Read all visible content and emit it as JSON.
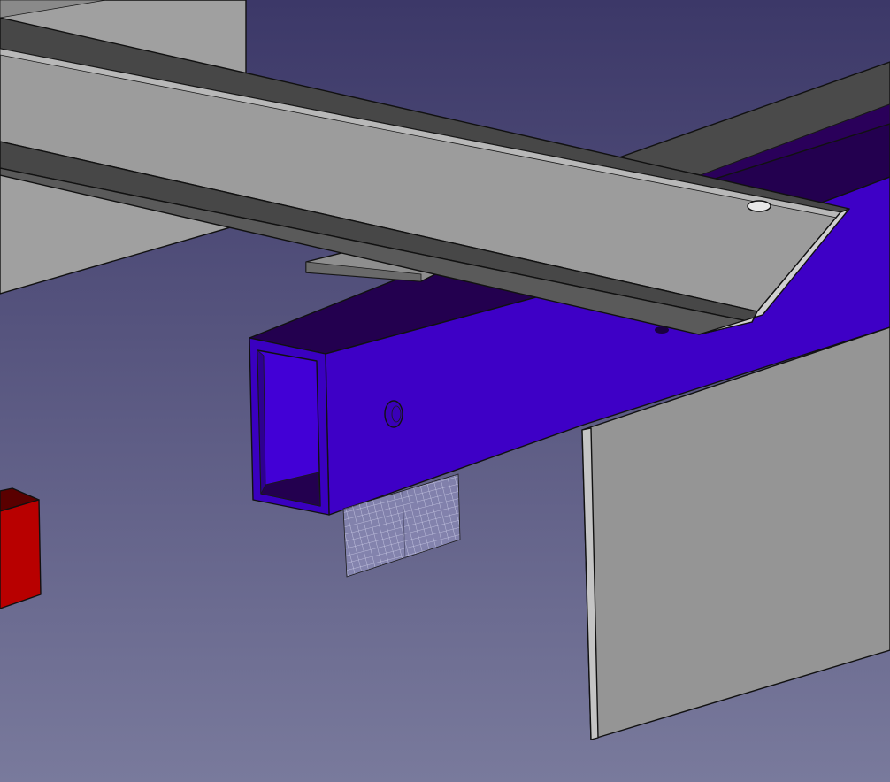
{
  "viewer": {
    "mode": "3d-cad-viewport",
    "background": {
      "top": "#3c3868",
      "bottom": "#797a9c"
    },
    "selection_color": "#3c00c8",
    "colors": {
      "beam_face_light": "#9c9c9c",
      "beam_face_dark": "#474747",
      "frame_front": "#3e00c6",
      "frame_top": "#23004f",
      "plate": "#959595",
      "red_block": "#b80000",
      "mesh": "#c8c8e6"
    }
  },
  "scene": {
    "objects": [
      {
        "id": "back-panel",
        "kind": "panel",
        "color": "#9e9e9e"
      },
      {
        "id": "rail-angle",
        "kind": "angle-profile",
        "color": "#9c9c9c",
        "holes": 1
      },
      {
        "id": "support-flat",
        "kind": "flat-bar",
        "color": "#8e8e8e"
      },
      {
        "id": "tube-frame",
        "kind": "rectangular-tube",
        "color": "#3e00c6",
        "selected": true,
        "holes": 1
      },
      {
        "id": "vertical-plate",
        "kind": "plate",
        "color": "#959595"
      },
      {
        "id": "red-block",
        "kind": "block",
        "color": "#b80000"
      },
      {
        "id": "mesh-patch",
        "kind": "wire-mesh",
        "color": "#c8c8e6"
      }
    ]
  }
}
